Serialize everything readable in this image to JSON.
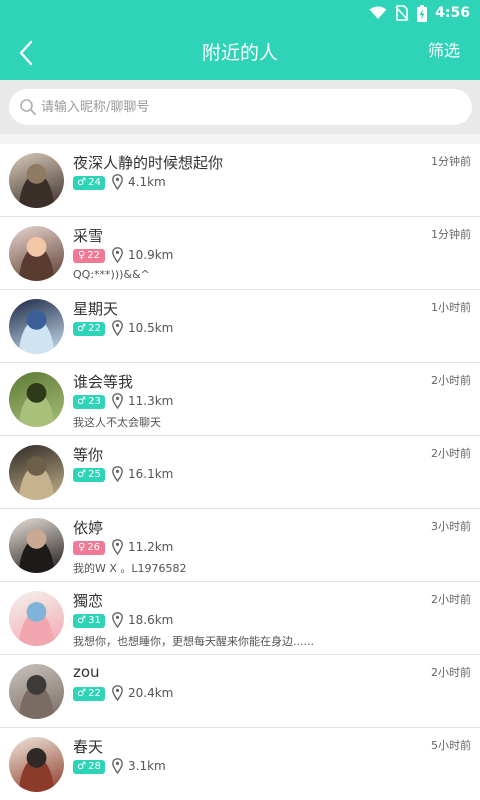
{
  "status": {
    "time": "4:56"
  },
  "header": {
    "title": "附近的人",
    "filter_label": "筛选"
  },
  "search": {
    "placeholder": "请输入昵称/聊聊号"
  },
  "users": [
    {
      "name": "夜深人静的时候想起你",
      "gender": "male",
      "gender_symbol": "♂",
      "age": "24",
      "distance": "4.1km",
      "time": "1分钟前",
      "signature": "",
      "avatar_colors": [
        "#d8cbb8",
        "#3b2f2a",
        "#8f7a63"
      ]
    },
    {
      "name": "采雪",
      "gender": "female",
      "gender_symbol": "♀",
      "age": "22",
      "distance": "10.9km",
      "time": "1分钟前",
      "signature": "QQ:***)))&&^",
      "avatar_colors": [
        "#e9d6d0",
        "#5a3b2f",
        "#f1c7a6"
      ]
    },
    {
      "name": "星期天",
      "gender": "male",
      "gender_symbol": "♂",
      "age": "22",
      "distance": "10.5km",
      "time": "1小时前",
      "signature": "",
      "avatar_colors": [
        "#1c2845",
        "#cfe3f3",
        "#3b5f99"
      ]
    },
    {
      "name": "谁会等我",
      "gender": "male",
      "gender_symbol": "♂",
      "age": "23",
      "distance": "11.3km",
      "time": "2小时前",
      "signature": "我这人不太会聊天",
      "avatar_colors": [
        "#5e7a36",
        "#a8c07a",
        "#2f3a1b"
      ]
    },
    {
      "name": "等你",
      "gender": "male",
      "gender_symbol": "♂",
      "age": "25",
      "distance": "16.1km",
      "time": "2小时前",
      "signature": "",
      "avatar_colors": [
        "#2e2a24",
        "#c7b28e",
        "#6e5f49"
      ]
    },
    {
      "name": "依婷",
      "gender": "female",
      "gender_symbol": "♀",
      "age": "26",
      "distance": "11.2km",
      "time": "3小时前",
      "signature": "我的W X 。L1976582",
      "avatar_colors": [
        "#e8e0da",
        "#1e1a19",
        "#c9a994"
      ]
    },
    {
      "name": "獨恋",
      "gender": "male",
      "gender_symbol": "♂",
      "age": "31",
      "distance": "18.6km",
      "time": "2小时前",
      "signature": "我想你，也想睡你，更想每天醒来你能在身边......",
      "avatar_colors": [
        "#f5f2ee",
        "#f2a7b0",
        "#7fb4d8"
      ]
    },
    {
      "name": "zou",
      "gender": "male",
      "gender_symbol": "♂",
      "age": "22",
      "distance": "20.4km",
      "time": "2小时前",
      "signature": "",
      "avatar_colors": [
        "#c9c3bd",
        "#7a6c63",
        "#3e3a3a"
      ]
    },
    {
      "name": "春天",
      "gender": "male",
      "gender_symbol": "♂",
      "age": "28",
      "distance": "3.1km",
      "time": "5小时前",
      "signature": "",
      "avatar_colors": [
        "#efe6da",
        "#8c3b2a",
        "#2f2a26"
      ]
    }
  ]
}
